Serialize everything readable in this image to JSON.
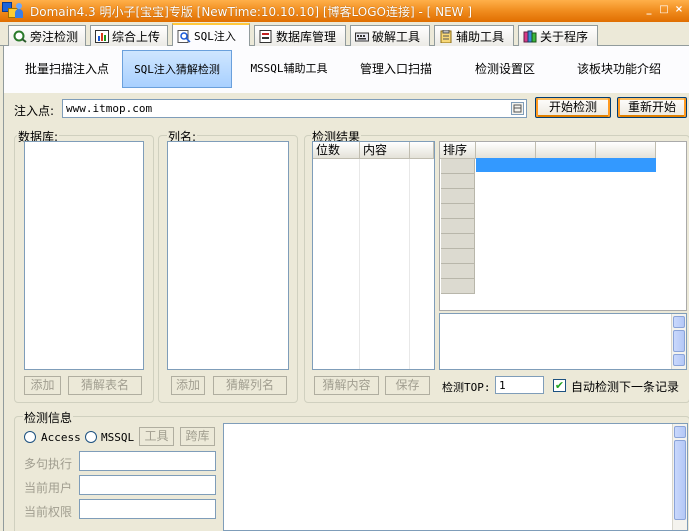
{
  "window": {
    "title": "Domain4.3 明小子[宝宝]专版 [NewTime:10.10.10] [博客LOGO连接]  - [ NEW ]",
    "controls": [
      "_",
      "□",
      "×"
    ]
  },
  "tabs": [
    {
      "label": "旁注检测",
      "icon": "magnifier-icon"
    },
    {
      "label": "综合上传",
      "icon": "chart-icon"
    },
    {
      "label": "SQL注入",
      "icon": "search-doc-icon"
    },
    {
      "label": "数据库管理",
      "icon": "database-icon"
    },
    {
      "label": "破解工具",
      "icon": "keyboard-icon"
    },
    {
      "label": "辅助工具",
      "icon": "clipboard-icon"
    },
    {
      "label": "关于程序",
      "icon": "books-icon"
    }
  ],
  "subnav": [
    "批量扫描注入点",
    "SQL注入猜解检测",
    "MSSQL辅助工具",
    "管理入口扫描",
    "检测设置区",
    "该板块功能介绍"
  ],
  "inject": {
    "label": "注入点:",
    "value": "www.itmop.com",
    "start_button": "开始检测",
    "restart_button": "重新开始"
  },
  "database_group": {
    "title": "数据库:",
    "add_button": "添加",
    "guess_button": "猜解表名"
  },
  "column_group": {
    "title": "列名:",
    "add_button": "添加",
    "guess_button": "猜解列名"
  },
  "result_group": {
    "title": "检测结果",
    "col_position": "位数",
    "col_content": "内容",
    "sort_header": "排序",
    "guess_button": "猜解内容",
    "save_button": "保存",
    "top_label": "检测TOP:",
    "top_value": "1",
    "auto_label": "自动检测下一条记录",
    "auto_checked": true
  },
  "info_group": {
    "title": "检测信息",
    "radio_access": "Access",
    "radio_mssql": "MSSQL",
    "tools_button": "工具",
    "cross_button": "跨库",
    "multi_exec_label": "多句执行",
    "current_user_label": "当前用户",
    "current_perm_label": "当前权限"
  }
}
